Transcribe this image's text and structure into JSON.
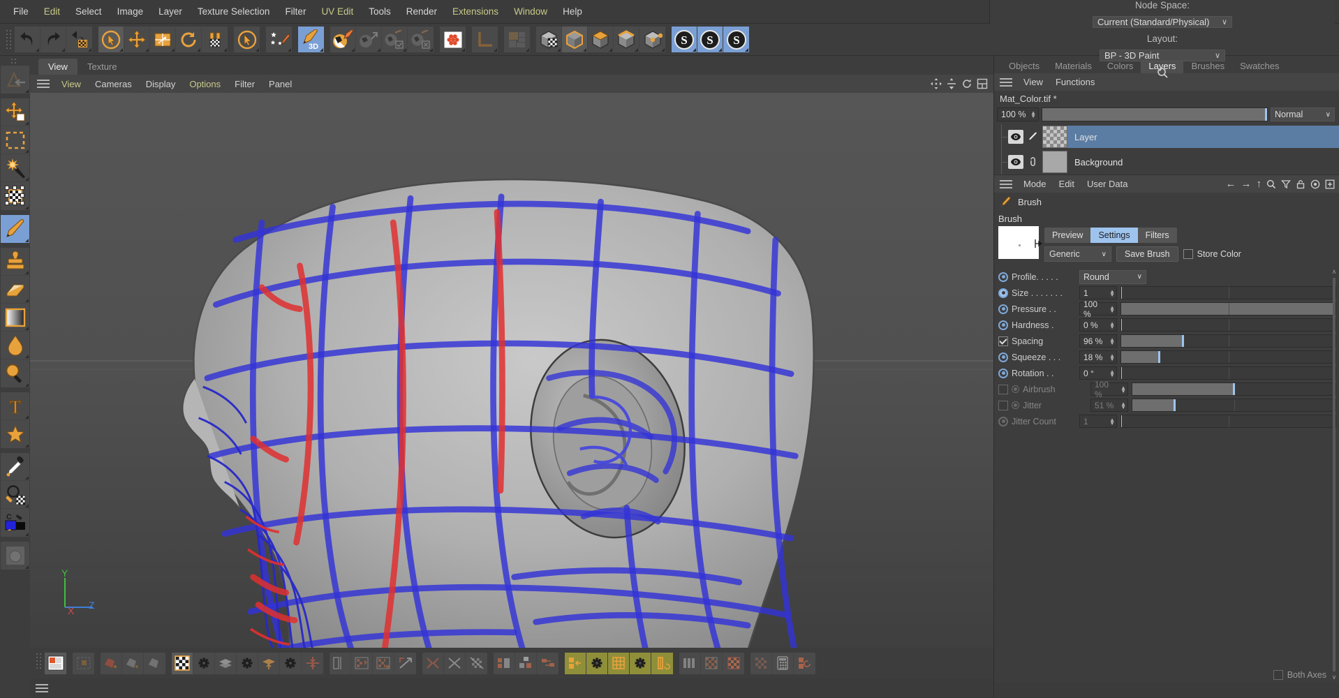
{
  "menubar": {
    "items": [
      {
        "label": "File",
        "accent": false
      },
      {
        "label": "Edit",
        "accent": true
      },
      {
        "label": "Select",
        "accent": false
      },
      {
        "label": "Image",
        "accent": false
      },
      {
        "label": "Layer",
        "accent": false
      },
      {
        "label": "Texture Selection",
        "accent": false
      },
      {
        "label": "Filter",
        "accent": false
      },
      {
        "label": "UV Edit",
        "accent": true
      },
      {
        "label": "Tools",
        "accent": false
      },
      {
        "label": "Render",
        "accent": false
      },
      {
        "label": "Extensions",
        "accent": true
      },
      {
        "label": "Window",
        "accent": true
      },
      {
        "label": "Help",
        "accent": false
      }
    ],
    "node_space_label": "Node Space:",
    "node_space_value": "Current (Standard/Physical)",
    "layout_label": "Layout:",
    "layout_value": "BP - 3D Paint",
    "search_icon": "search-icon"
  },
  "toolbar": {
    "groups": [
      {
        "name": "history",
        "buttons": [
          {
            "name": "undo-button",
            "icon": "undo-arrow"
          },
          {
            "name": "redo-button",
            "icon": "redo-arrow"
          },
          {
            "name": "undo-texture-button",
            "icon": "undo-texture"
          }
        ]
      },
      {
        "name": "transform",
        "buttons": [
          {
            "name": "select-tool-button",
            "icon": "cursor-circle",
            "state": "selected"
          },
          {
            "name": "move-tool-button",
            "icon": "move-cross"
          },
          {
            "name": "scale-tool-button",
            "icon": "scale-box"
          },
          {
            "name": "rotate-tool-button",
            "icon": "rotate-circle"
          },
          {
            "name": "snap-texture-button",
            "icon": "magnet-checker"
          }
        ]
      },
      {
        "name": "paint-select",
        "buttons": [
          {
            "name": "paint-select-button",
            "icon": "cursor-circle"
          }
        ]
      },
      {
        "name": "brush-presets",
        "buttons": [
          {
            "name": "brush-presets-button",
            "icon": "stars-brush"
          }
        ]
      },
      {
        "name": "paint3d",
        "buttons": [
          {
            "name": "paint-3d-button",
            "icon": "brush-3d",
            "state": "active"
          }
        ]
      },
      {
        "name": "material-paint",
        "buttons": [
          {
            "name": "material-paint-button",
            "icon": "sphere-brush"
          },
          {
            "name": "material-arrow-button",
            "icon": "sphere-arrow",
            "state": "disabled"
          },
          {
            "name": "material-check-button",
            "icon": "sphere-check",
            "state": "disabled"
          },
          {
            "name": "material-x-button",
            "icon": "sphere-x",
            "state": "disabled"
          }
        ]
      },
      {
        "name": "texture-wizard",
        "buttons": [
          {
            "name": "texture-wizard-button",
            "icon": "texture-red"
          }
        ]
      },
      {
        "name": "axis",
        "buttons": [
          {
            "name": "axis-button",
            "icon": "axis-L",
            "state": "disabled"
          }
        ]
      },
      {
        "name": "layout-grid",
        "buttons": [
          {
            "name": "layout-grid-button",
            "icon": "grid-panels",
            "state": "disabled"
          }
        ]
      },
      {
        "name": "modes",
        "buttons": [
          {
            "name": "texture-mode-button",
            "icon": "cube-checker"
          },
          {
            "name": "model-mode-button",
            "icon": "cube-outline",
            "state": "selected"
          },
          {
            "name": "polygon-mode-button",
            "icon": "cube-top"
          },
          {
            "name": "edge-mode-button",
            "icon": "cube-edge"
          },
          {
            "name": "point-mode-button",
            "icon": "cube-points"
          }
        ]
      },
      {
        "name": "snap-s",
        "buttons": [
          {
            "name": "snap-s1-button",
            "icon": "letter-S-circle",
            "state": "active"
          },
          {
            "name": "snap-s2-button",
            "icon": "letter-S-circle",
            "state": "active"
          },
          {
            "name": "snap-s3-button",
            "icon": "letter-S-circle",
            "state": "active"
          }
        ]
      }
    ]
  },
  "left_tools": {
    "groups": [
      {
        "buttons": [
          {
            "name": "previous-tool-button",
            "icon": "arrow-back-tool",
            "state": "disabled"
          }
        ]
      },
      {
        "buttons": [
          {
            "name": "move-tool",
            "icon": "move-arrows"
          },
          {
            "name": "rectangle-select-tool",
            "icon": "marquee-dashed"
          },
          {
            "name": "magic-wand-tool",
            "icon": "magic-wand"
          },
          {
            "name": "transform-texture-tool",
            "icon": "transform-checker"
          }
        ]
      },
      {
        "buttons": [
          {
            "name": "brush-tool",
            "icon": "paint-brush",
            "state": "active"
          }
        ]
      },
      {
        "buttons": [
          {
            "name": "clone-stamp-tool",
            "icon": "stamp"
          },
          {
            "name": "eraser-tool",
            "icon": "eraser"
          },
          {
            "name": "gradient-tool",
            "icon": "gradient-square"
          },
          {
            "name": "fill-tool",
            "icon": "paint-drop"
          },
          {
            "name": "blur-tool",
            "icon": "blur-magnifier"
          }
        ]
      },
      {
        "buttons": [
          {
            "name": "text-tool",
            "icon": "letter-T"
          },
          {
            "name": "shape-tool",
            "icon": "star-shape"
          }
        ]
      },
      {
        "buttons": [
          {
            "name": "color-picker-tool",
            "icon": "eyedropper"
          },
          {
            "name": "zoom-texture-tool",
            "icon": "magnifier-checker"
          },
          {
            "name": "color-swatch-tool",
            "icon": "color-swatch-blue"
          }
        ]
      },
      {
        "buttons": [
          {
            "name": "render-preview-button",
            "icon": "sphere-grey",
            "state": "disabled"
          }
        ]
      }
    ]
  },
  "viewport": {
    "tabs": [
      {
        "label": "View",
        "active": true
      },
      {
        "label": "Texture",
        "active": false
      }
    ],
    "menu": [
      {
        "label": "View",
        "accent": true
      },
      {
        "label": "Cameras",
        "accent": false
      },
      {
        "label": "Display",
        "accent": false
      },
      {
        "label": "Options",
        "accent": true
      },
      {
        "label": "Filter",
        "accent": false
      },
      {
        "label": "Panel",
        "accent": false
      }
    ],
    "corner_icons": [
      {
        "name": "viewport-pan-icon",
        "glyph": "move"
      },
      {
        "name": "viewport-dolly-icon",
        "glyph": "dolly"
      },
      {
        "name": "viewport-rotate-icon",
        "glyph": "rotate"
      },
      {
        "name": "viewport-maximize-icon",
        "glyph": "panels"
      }
    ],
    "axis_gizmo": {
      "x": "X",
      "y": "Y",
      "z": "Z",
      "x_color": "#d84a4a",
      "y_color": "#4ec24e",
      "z_color": "#4a7fd8"
    },
    "content_description": "3D head model side view with blue and red UV/edge wireframe overlay"
  },
  "bottom_toolbar": {
    "groups": [
      {
        "buttons": [
          {
            "name": "texture-view-button",
            "icon": "texture-view",
            "state": "selected"
          }
        ]
      },
      {
        "buttons": [
          {
            "name": "uv-mesh-button",
            "icon": "uv-mesh",
            "state": "disabled"
          }
        ]
      },
      {
        "buttons": [
          {
            "name": "uv-polygon-button",
            "icon": "uv-poly-red"
          },
          {
            "name": "uv-point-button",
            "icon": "uv-point-grey"
          },
          {
            "name": "uv-edge-button",
            "icon": "uv-edge-grey"
          }
        ]
      },
      {
        "buttons": [
          {
            "name": "uv-checker-button",
            "icon": "checker-square",
            "state": "selected"
          },
          {
            "name": "uv-checker-settings-button",
            "icon": "gear"
          },
          {
            "name": "uv-relax-button",
            "icon": "relax-layers"
          },
          {
            "name": "uv-relax-settings-button",
            "icon": "gear"
          },
          {
            "name": "uv-project-button",
            "icon": "project-arrow"
          },
          {
            "name": "uv-project-settings-button",
            "icon": "gear"
          },
          {
            "name": "uv-fit-button",
            "icon": "fit-arrows-red"
          }
        ]
      },
      {
        "buttons": [
          {
            "name": "uv-mirror-u-button",
            "icon": "mirror-u"
          },
          {
            "name": "uv-mirror-checker1-button",
            "icon": "mirror-checker-1"
          },
          {
            "name": "uv-mirror-checker2-button",
            "icon": "mirror-checker-2"
          },
          {
            "name": "uv-flip-button",
            "icon": "flip-diagonal"
          }
        ]
      },
      {
        "buttons": [
          {
            "name": "uv-align-x-button",
            "icon": "align-x-red"
          },
          {
            "name": "uv-scatter-button",
            "icon": "scatter-arrows"
          },
          {
            "name": "uv-collapse-button",
            "icon": "collapse-checker"
          }
        ]
      },
      {
        "buttons": [
          {
            "name": "uv-layout-a-button",
            "icon": "layout-a"
          },
          {
            "name": "uv-layout-b-button",
            "icon": "layout-b"
          },
          {
            "name": "uv-layout-c-button",
            "icon": "layout-c"
          }
        ]
      },
      {
        "buttons": [
          {
            "name": "uv-optimal-map-button",
            "icon": "optimal-map",
            "state": "highlight"
          },
          {
            "name": "uv-optimal-settings-button",
            "icon": "gear",
            "state": "highlight"
          },
          {
            "name": "uv-grid-button",
            "icon": "grid-orange",
            "state": "highlight"
          },
          {
            "name": "uv-grid-settings-button",
            "icon": "gear",
            "state": "highlight"
          },
          {
            "name": "uv-realign-button",
            "icon": "realign-orange",
            "state": "highlight"
          }
        ]
      },
      {
        "buttons": [
          {
            "name": "uv-pack-button",
            "icon": "pack-strips"
          },
          {
            "name": "uv-relax2-button",
            "icon": "relax-checker-1"
          },
          {
            "name": "uv-relax3-button",
            "icon": "relax-checker-2"
          }
        ]
      },
      {
        "buttons": [
          {
            "name": "uv-transfer-button",
            "icon": "transfer-checker"
          },
          {
            "name": "uv-calculator-button",
            "icon": "calculator"
          },
          {
            "name": "uv-reset-button",
            "icon": "reset-orange"
          }
        ]
      }
    ]
  },
  "right_panel": {
    "tabs": [
      {
        "label": "Objects",
        "active": false
      },
      {
        "label": "Materials",
        "active": false
      },
      {
        "label": "Colors",
        "active": false
      },
      {
        "label": "Layers",
        "active": true
      },
      {
        "label": "Brushes",
        "active": false
      },
      {
        "label": "Swatches",
        "active": false
      }
    ],
    "menu": [
      {
        "label": "View"
      },
      {
        "label": "Functions"
      }
    ],
    "filename": "Mat_Color.tif *",
    "opacity_value": "100 %",
    "opacity_percent": 100,
    "blend_mode": "Normal",
    "layers": [
      {
        "name": "Layer",
        "selected": true,
        "visible": true,
        "thumb": "checker",
        "mini_icon": "brush-icon"
      },
      {
        "name": "Background",
        "selected": false,
        "visible": true,
        "thumb": "grey",
        "mini_icon": "link-icon"
      }
    ]
  },
  "attributes": {
    "menu": [
      {
        "label": "Mode"
      },
      {
        "label": "Edit"
      },
      {
        "label": "User Data"
      }
    ],
    "icons": [
      {
        "name": "nav-back-icon",
        "glyph": "←"
      },
      {
        "name": "nav-forward-icon",
        "glyph": "→"
      },
      {
        "name": "nav-up-icon",
        "glyph": "↑"
      },
      {
        "name": "search-icon",
        "glyph": "search"
      },
      {
        "name": "filter-icon",
        "glyph": "funnel"
      },
      {
        "name": "lock-icon",
        "glyph": "lock"
      },
      {
        "name": "target-icon",
        "glyph": "target"
      },
      {
        "name": "add-icon",
        "glyph": "plus-box"
      }
    ],
    "object_name": "Brush",
    "object_icon": "brush-icon",
    "section_title": "Brush",
    "brush_tabs": [
      {
        "label": "Preview",
        "active": false
      },
      {
        "label": "Settings",
        "active": true
      },
      {
        "label": "Filters",
        "active": false
      }
    ],
    "preset_value": "Generic",
    "save_brush_label": "Save Brush",
    "store_color_label": "Store Color",
    "store_color_checked": false,
    "params": [
      {
        "name": "profile",
        "label": "Profile. . . . .",
        "control": "select",
        "value": "Round",
        "enabled": true,
        "radio": "ring"
      },
      {
        "name": "size",
        "label": "Size  . . . . . . .",
        "control": "slider",
        "value": "1",
        "percent": 0,
        "enabled": true,
        "radio": "filled"
      },
      {
        "name": "pressure",
        "label": "Pressure . .",
        "control": "slider",
        "value": "100 %",
        "percent": 100,
        "enabled": true,
        "radio": "ring"
      },
      {
        "name": "hardness",
        "label": "Hardness  .",
        "control": "slider",
        "value": "0 %",
        "percent": 0,
        "enabled": true,
        "radio": "ring"
      },
      {
        "name": "spacing",
        "label": "Spacing",
        "control": "slider",
        "value": "96 %",
        "percent": 29,
        "enabled": true,
        "radio": "checkbox",
        "checked": true
      },
      {
        "name": "squeeze",
        "label": "Squeeze . . .",
        "control": "slider",
        "value": "18 %",
        "percent": 18,
        "enabled": true,
        "radio": "ring"
      },
      {
        "name": "rotation",
        "label": "Rotation . .",
        "control": "slider",
        "value": "0 °",
        "percent": 0,
        "enabled": true,
        "radio": "ring"
      },
      {
        "name": "airbrush",
        "label": "Airbrush",
        "control": "slider",
        "value": "100 %",
        "percent": 50,
        "enabled": false,
        "radio": "checkbox-dim",
        "checked": false
      },
      {
        "name": "jitter",
        "label": "Jitter",
        "control": "slider",
        "value": "51 %",
        "percent": 21,
        "enabled": false,
        "radio": "checkbox-dim",
        "checked": false
      },
      {
        "name": "jitter_count",
        "label": "Jitter Count",
        "control": "slider",
        "value": "1",
        "percent": 0,
        "enabled": false,
        "radio": "ring-dim"
      }
    ],
    "both_axes_label": "Both Axes",
    "both_axes_checked": false
  }
}
